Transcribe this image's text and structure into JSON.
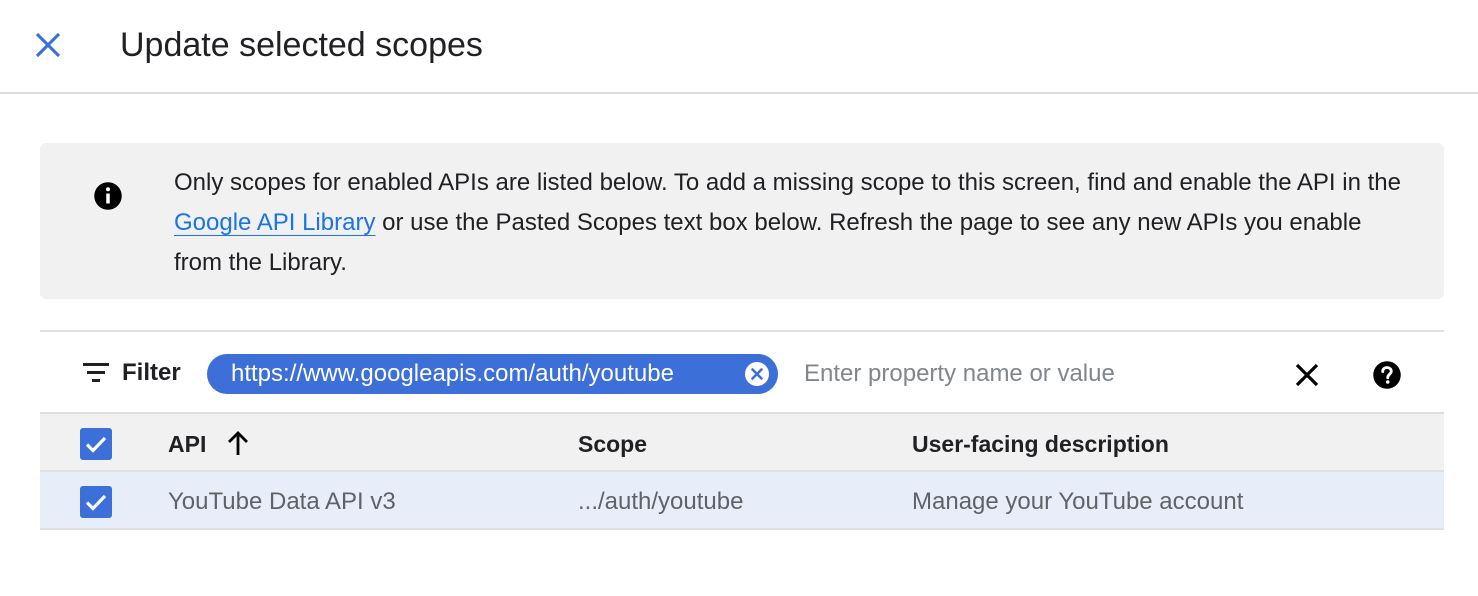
{
  "dialog": {
    "title": "Update selected scopes",
    "close_icon": "close-icon"
  },
  "banner": {
    "icon": "info-icon",
    "text_before": "Only scopes for enabled APIs are listed below. To add a missing scope to this screen, find and enable the API in the ",
    "link": "Google API Library",
    "text_after": " or use the Pasted Scopes text box below. Refresh the page to see any new APIs you enable from the Library."
  },
  "filter": {
    "label": "Filter",
    "icon": "filter-icon",
    "chip": "https://www.googleapis.com/auth/youtube",
    "placeholder": "Enter property name or value",
    "value": "",
    "clear_icon": "close-icon",
    "help_icon": "help-icon"
  },
  "table": {
    "columns": [
      "API",
      "Scope",
      "User-facing description"
    ],
    "sort_icon": "arrow-up-icon",
    "header_checked": true,
    "rows": [
      {
        "checked": true,
        "api": "YouTube Data API v3",
        "scope": ".../auth/youtube",
        "description": "Manage your YouTube account"
      }
    ]
  },
  "colors": {
    "accent": "#3c6fd8",
    "link": "#1a73e8",
    "banner_bg": "#f1f1f1",
    "selected_row_bg": "#e8eef9"
  }
}
